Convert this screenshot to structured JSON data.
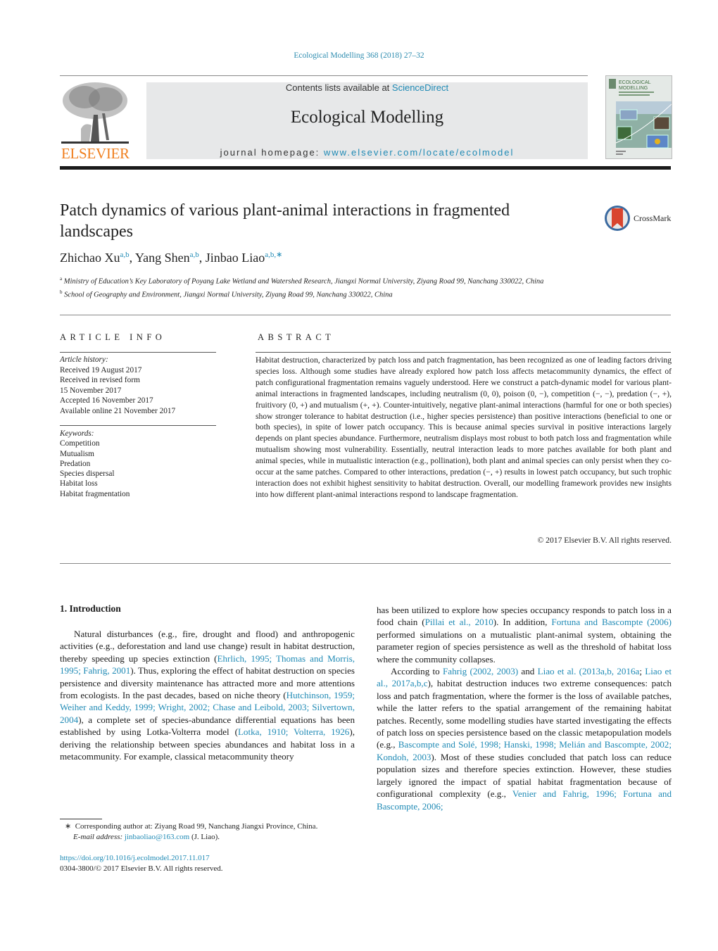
{
  "header": {
    "citation": "Ecological Modelling 368 (2018) 27–32",
    "contents_prefix": "Contents lists available at ",
    "contents_link": "ScienceDirect",
    "journal_title": "Ecological Modelling",
    "homepage_prefix": "journal homepage: ",
    "homepage_link": "www.elsevier.com/locate/ecolmodel",
    "publisher_logo_text": "ELSEVIER",
    "cover_title_line1": "ECOLOGICAL",
    "cover_title_line2": "MODELLING",
    "crossmark_label": "CrossMark"
  },
  "article": {
    "title": "Patch dynamics of various plant-animal interactions in fragmented landscapes",
    "authors": [
      {
        "name": "Zhichao Xu",
        "affil": "a,b"
      },
      {
        "name": "Yang Shen",
        "affil": "a,b"
      },
      {
        "name": "Jinbao Liao",
        "affil": "a,b,∗"
      }
    ],
    "affiliations": [
      {
        "mark": "a",
        "text": "Ministry of Education’s Key Laboratory of Poyang Lake Wetland and Watershed Research, Jiangxi Normal University, Ziyang Road 99, Nanchang 330022, China"
      },
      {
        "mark": "b",
        "text": "School of Geography and Environment, Jiangxi Normal University, Ziyang Road 99, Nanchang 330022, China"
      }
    ]
  },
  "article_info": {
    "label": "ARTICLE INFO",
    "history_label": "Article history:",
    "history": [
      "Received 19 August 2017",
      "Received in revised form",
      "15 November 2017",
      "Accepted 16 November 2017",
      "Available online 21 November 2017"
    ],
    "keywords_label": "Keywords:",
    "keywords": [
      "Competition",
      "Mutualism",
      "Predation",
      "Species dispersal",
      "Habitat loss",
      "Habitat fragmentation"
    ]
  },
  "abstract": {
    "label": "ABSTRACT",
    "text": "Habitat destruction, characterized by patch loss and patch fragmentation, has been recognized as one of leading factors driving species loss. Although some studies have already explored how patch loss affects metacommunity dynamics, the effect of patch configurational fragmentation remains vaguely understood. Here we construct a patch-dynamic model for various plant-animal interactions in fragmented landscapes, including neutralism (0, 0), poison (0, −), competition (−, −), predation (−, +), fruitivory (0, +) and mutualism (+, +). Counter-intuitively, negative plant-animal interactions (harmful for one or both species) show stronger tolerance to habitat destruction (i.e., higher species persistence) than positive interactions (beneficial to one or both species), in spite of lower patch occupancy. This is because animal species survival in positive interactions largely depends on plant species abundance. Furthermore, neutralism displays most robust to both patch loss and fragmentation while mutualism showing most vulnerability. Essentially, neutral interaction leads to more patches available for both plant and animal species, while in mutualistic interaction (e.g., pollination), both plant and animal species can only persist when they co-occur at the same patches. Compared to other interactions, predation (−, +) results in lowest patch occupancy, but such trophic interaction does not exhibit highest sensitivity to habitat destruction. Overall, our modelling framework provides new insights into how different plant-animal interactions respond to landscape fragmentation.",
    "copyright": "© 2017 Elsevier B.V. All rights reserved."
  },
  "body": {
    "section_heading": "1.  Introduction",
    "left": {
      "p1_a": "Natural disturbances (e.g., fire, drought and flood) and anthropogenic activities (e.g., deforestation and land use change) result in habitat destruction, thereby speeding up species extinction (",
      "p1_ref1": "Ehrlich, 1995; Thomas and Morris, 1995; Fahrig, 2001",
      "p1_b": "). Thus, exploring the effect of habitat destruction on species persistence and diversity maintenance has attracted more and more attentions from ecologists. In the past decades, based on niche theory (",
      "p1_ref2": "Hutchinson, 1959; Weiher and Keddy, 1999; Wright, 2002; Chase and Leibold, 2003; Silvertown, 2004",
      "p1_c": "), a complete set of species-abundance differential equations has been established by using Lotka-Volterra model (",
      "p1_ref3": "Lotka, 1910; Volterra, 1926",
      "p1_d": "), deriving the relationship between species abundances and habitat loss in a metacommunity. For example, classical metacommunity theory"
    },
    "right": {
      "p1_a": "has been utilized to explore how species occupancy responds to patch loss in a food chain (",
      "p1_ref1": "Pillai et al., 2010",
      "p1_b": "). In addition, ",
      "p1_ref2": "Fortuna and Bascompte (2006)",
      "p1_c": " performed simulations on a mutualistic plant-animal system, obtaining the parameter region of species persistence as well as the threshold of habitat loss where the community collapses.",
      "p2_a": "According to ",
      "p2_ref1": "Fahrig (2002, 2003)",
      "p2_b": " and ",
      "p2_ref2": "Liao et al. (2013a,b, 2016a",
      "p2_c": "; ",
      "p2_ref3": "Liao et al., 2017a,b,c",
      "p2_d": "), habitat destruction induces two extreme consequences: patch loss and patch fragmentation, where the former is the loss of available patches, while the latter refers to the spatial arrangement of the remaining habitat patches. Recently, some modelling studies have started investigating the effects of patch loss on species persistence based on the classic metapopulation models (e.g., ",
      "p2_ref4": "Bascompte and Solé, 1998; Hanski, 1998; Melián and Bascompte, 2002; Kondoh, 2003",
      "p2_e": "). Most of these studies concluded that patch loss can reduce population sizes and therefore species extinction. However, these studies largely ignored the impact of spatial habitat fragmentation because of configurational complexity (e.g., ",
      "p2_ref5": "Venier and Fahrig, 1996; Fortuna and Bascompte, 2006;"
    }
  },
  "footnote": {
    "mark": "∗",
    "corresponding": "Corresponding author at: Ziyang Road 99, Nanchang Jiangxi Province, China.",
    "email_label": "E-mail address:",
    "email": "jinbaoliao@163.com",
    "email_suffix": " (J. Liao).",
    "doi": "https://doi.org/10.1016/j.ecolmodel.2017.11.017",
    "issn": "0304-3800/© 2017 Elsevier B.V. All rights reserved."
  }
}
